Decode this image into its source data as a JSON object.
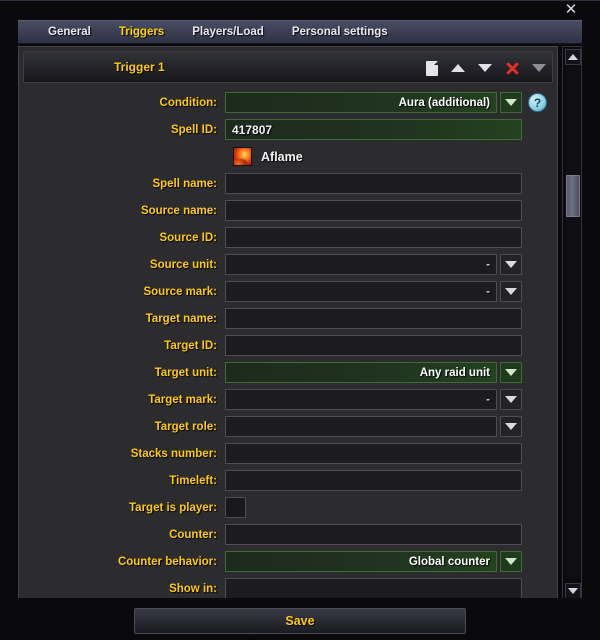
{
  "window": {
    "close_label": "✕"
  },
  "tabs": [
    {
      "label": "General",
      "active": false
    },
    {
      "label": "Triggers",
      "active": true
    },
    {
      "label": "Players/Load",
      "active": false
    },
    {
      "label": "Personal settings",
      "active": false
    }
  ],
  "trigger": {
    "title": "Trigger 1",
    "header_icons": [
      {
        "name": "copy-icon"
      },
      {
        "name": "move-up-icon"
      },
      {
        "name": "move-down-icon"
      },
      {
        "name": "delete-icon"
      },
      {
        "name": "collapse-icon"
      }
    ]
  },
  "fields": [
    {
      "label": "Condition:",
      "value": "Aura (additional)",
      "type": "dropdown",
      "green": true,
      "help": true
    },
    {
      "label": "Spell ID:",
      "value": "417807",
      "type": "text",
      "green": true
    },
    {
      "label": "Spell name:",
      "value": "",
      "type": "text"
    },
    {
      "label": "Source name:",
      "value": "",
      "type": "text"
    },
    {
      "label": "Source ID:",
      "value": "",
      "type": "text"
    },
    {
      "label": "Source unit:",
      "value": "-",
      "type": "dropdown"
    },
    {
      "label": "Source mark:",
      "value": "-",
      "type": "dropdown"
    },
    {
      "label": "Target name:",
      "value": "",
      "type": "text"
    },
    {
      "label": "Target ID:",
      "value": "",
      "type": "text"
    },
    {
      "label": "Target unit:",
      "value": "Any raid unit",
      "type": "dropdown",
      "green": true
    },
    {
      "label": "Target mark:",
      "value": "-",
      "type": "dropdown"
    },
    {
      "label": "Target role:",
      "value": "",
      "type": "dropdown"
    },
    {
      "label": "Stacks number:",
      "value": "",
      "type": "text"
    },
    {
      "label": "Timeleft:",
      "value": "",
      "type": "text"
    },
    {
      "label": "Target is player:",
      "value": "",
      "type": "checkbox"
    },
    {
      "label": "Counter:",
      "value": "",
      "type": "text"
    },
    {
      "label": "Counter behavior:",
      "value": "Global counter",
      "type": "dropdown",
      "green": true
    },
    {
      "label": "Show in:",
      "value": "",
      "type": "text"
    }
  ],
  "spell": {
    "icon_name": "aflame-spell-icon",
    "name": "Aflame"
  },
  "help": {
    "label": "?"
  },
  "scrollbar": {
    "up_name": "scroll-up-arrow",
    "down_name": "scroll-down-arrow"
  },
  "footer": {
    "save_label": "Save"
  },
  "colors": {
    "accent_gold": "#ffc90e",
    "panel_bg": "#2c2c2e",
    "window_bg": "#0a0a0d",
    "green_field": "#23421f",
    "delete_red": "#e03023",
    "help_blue": "#8fd3e6"
  }
}
